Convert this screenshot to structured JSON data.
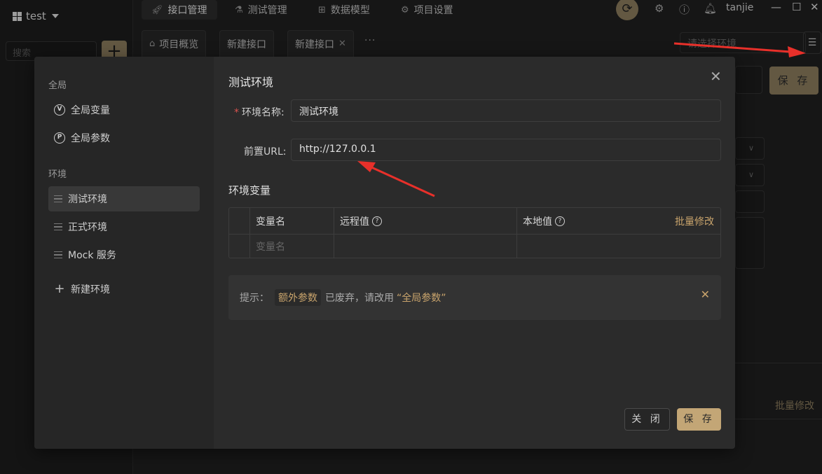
{
  "project": {
    "name": "test"
  },
  "search": {
    "placeholder": "搜索"
  },
  "nav_tabs": [
    {
      "label": "接口管理",
      "icon": "rocket-icon",
      "active": true
    },
    {
      "label": "测试管理",
      "icon": "flask-icon"
    },
    {
      "label": "数据模型",
      "icon": "hierarchy-icon"
    },
    {
      "label": "项目设置",
      "icon": "gear-icon"
    }
  ],
  "user": {
    "name": "tanjie"
  },
  "file_tabs": [
    {
      "label": "项目概览",
      "icon": "home-icon"
    },
    {
      "label": "新建接口"
    },
    {
      "label": "新建接口",
      "closable": true
    }
  ],
  "env_select": {
    "placeholder": "请选择环境"
  },
  "bg": {
    "save_label": "保 存",
    "batch_label": "批量修改"
  },
  "modal": {
    "sidebar": {
      "global_section": "全局",
      "global_items": [
        {
          "label": "全局变量",
          "badge": "V"
        },
        {
          "label": "全局参数",
          "badge": "P"
        }
      ],
      "env_section": "环境",
      "env_items": [
        {
          "label": "测试环境",
          "active": true
        },
        {
          "label": "正式环境"
        },
        {
          "label": "Mock 服务"
        }
      ],
      "new_env_label": "新建环境"
    },
    "title": "测试环境",
    "form": {
      "name_label": "环境名称:",
      "name_value": "测试环境",
      "url_label": "前置URL:",
      "url_value": "http://127.0.0.1"
    },
    "vars": {
      "heading": "环境变量",
      "columns": [
        "变量名",
        "远程值",
        "本地值"
      ],
      "batch_label": "批量修改",
      "row_placeholder": "变量名"
    },
    "tip": {
      "prefix": "提示：",
      "code": "额外参数",
      "middle": "已废弃，请改用",
      "highlight": "“全局参数”"
    },
    "close_label": "关 闭",
    "save_label": "保 存"
  },
  "colors": {
    "accent": "#c3a676",
    "annotation_arrow": "#e8302a"
  }
}
